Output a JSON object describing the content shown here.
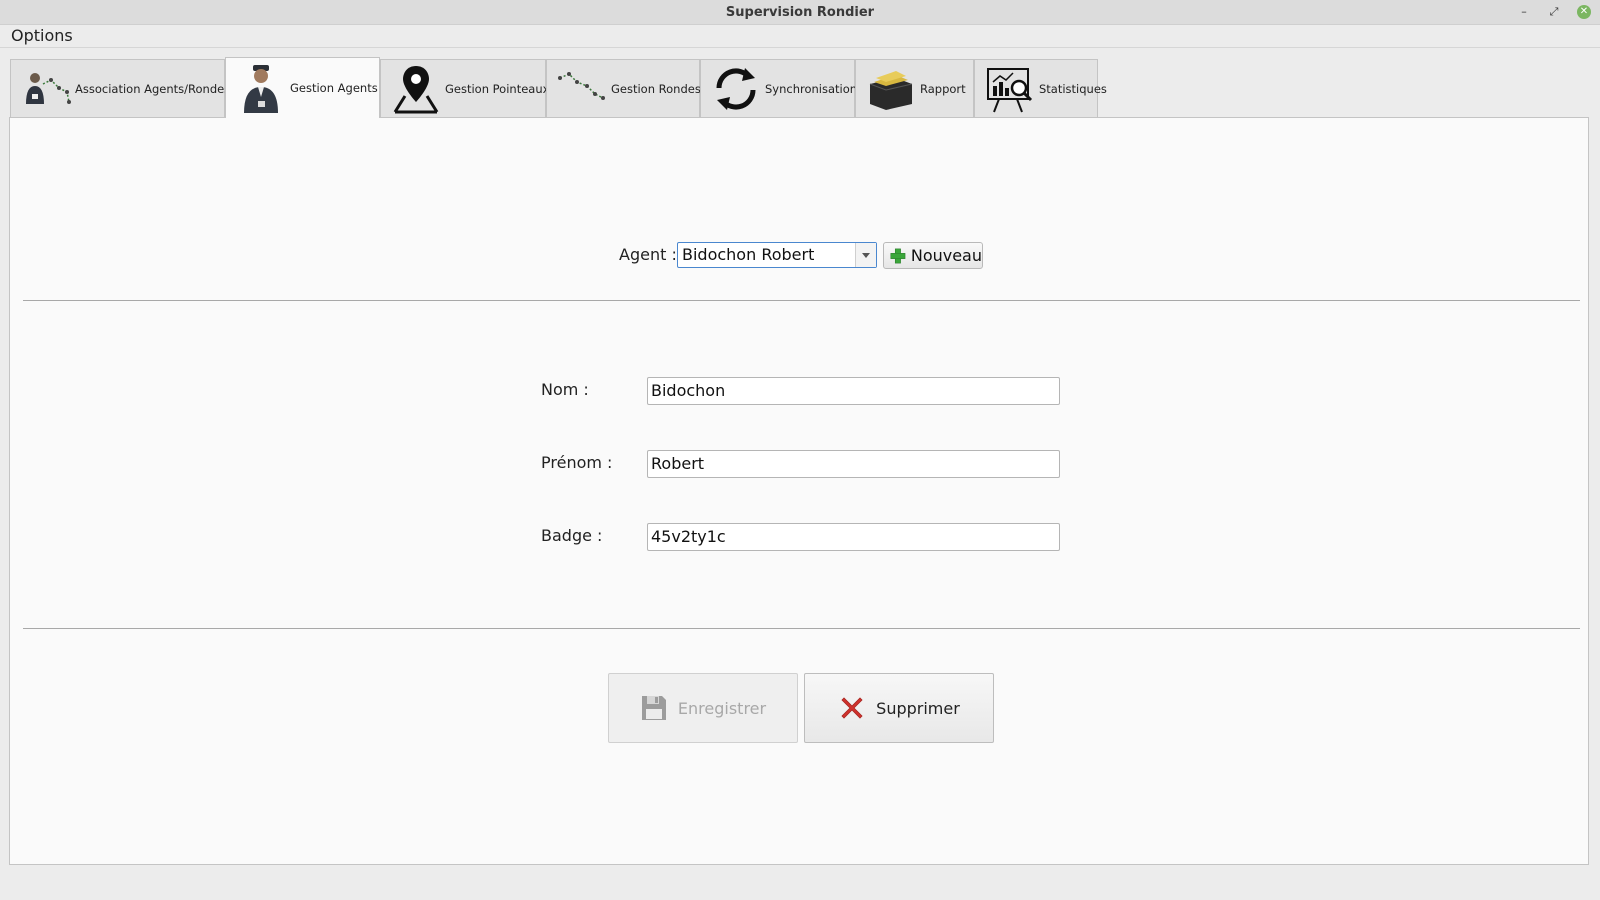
{
  "window": {
    "title": "Supervision Rondier"
  },
  "menu": {
    "options": "Options"
  },
  "tabs": [
    {
      "label": "Association Agents/Rondes",
      "icon": "agent-route-icon"
    },
    {
      "label": "Gestion Agents",
      "icon": "agent-icon",
      "active": true
    },
    {
      "label": "Gestion Pointeaux",
      "icon": "map-pin-icon"
    },
    {
      "label": "Gestion Rondes",
      "icon": "route-icon"
    },
    {
      "label": "Synchronisation",
      "icon": "sync-icon"
    },
    {
      "label": "Rapport",
      "icon": "report-box-icon"
    },
    {
      "label": "Statistiques",
      "icon": "statistics-icon"
    }
  ],
  "agent_selector": {
    "label": "Agent :",
    "value": "Bidochon Robert",
    "new_label": "Nouveau"
  },
  "form": {
    "nom": {
      "label": "Nom :",
      "value": "Bidochon"
    },
    "prenom": {
      "label": "Prénom :",
      "value": "Robert"
    },
    "badge": {
      "label": "Badge :",
      "value": "45v2ty1c"
    }
  },
  "actions": {
    "save_label": "Enregistrer",
    "save_enabled": false,
    "delete_label": "Supprimer"
  },
  "colors": {
    "accent": "#4a87cf",
    "plus": "#3aa63a",
    "delete": "#d0322d",
    "close": "#7bb661"
  }
}
